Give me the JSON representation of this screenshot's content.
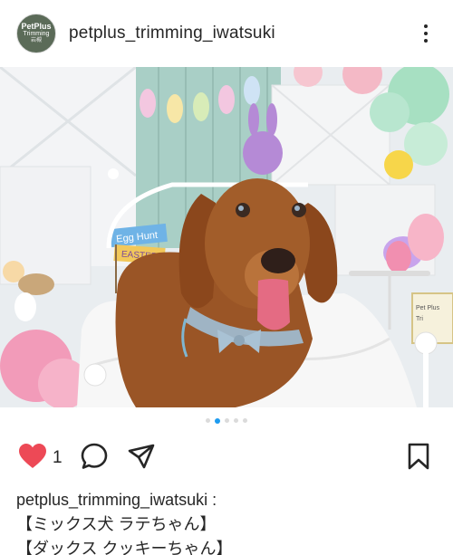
{
  "post": {
    "avatar": {
      "line1": "PetPlus",
      "line2": "Trimming",
      "line3": "岩槻"
    },
    "username": "petplus_trimming_iwatsuki",
    "more_icon": "more-vertical-icon",
    "photo": {
      "signs": [
        "Egg Hunt",
        "EASTER"
      ],
      "frame_text": [
        "Pet Plus",
        "Tri"
      ]
    },
    "carousel": {
      "count": 5,
      "active_index": 1
    },
    "actions": {
      "like_icon": "heart-filled-icon",
      "like_color": "#ed4956",
      "like_count": "1",
      "comment_icon": "comment-icon",
      "share_icon": "send-icon",
      "save_icon": "bookmark-icon"
    },
    "caption": {
      "username": "petplus_trimming_iwatsuki :",
      "lines": [
        "【ミックス犬 ラテちゃん】",
        "【ダックス クッキーちゃん】"
      ]
    }
  }
}
